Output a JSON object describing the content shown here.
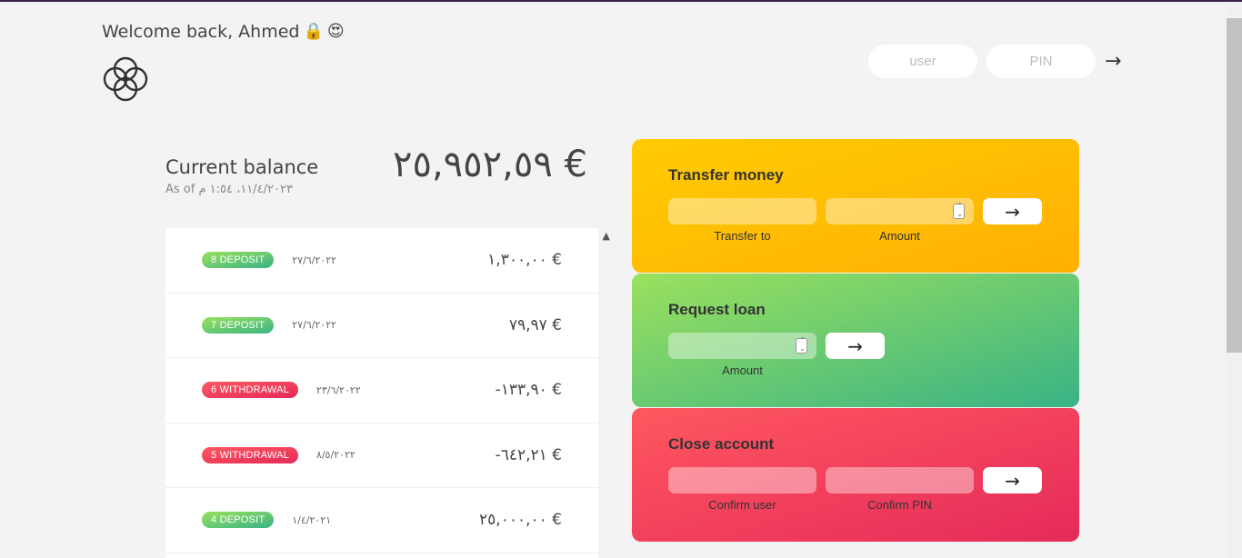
{
  "header": {
    "welcome": "Welcome back, Ahmed",
    "emoji_1": "🔒",
    "emoji_2": "😍",
    "user_placeholder": "user",
    "pin_placeholder": "PIN",
    "login_arrow": "→"
  },
  "balance": {
    "label": "Current balance",
    "date": "As of ١١/٤/٢٠٢٣، ١:٥٤ م",
    "value": "٢٥,٩٥٢,٥٩ €"
  },
  "movements": [
    {
      "type": "deposit",
      "label": "8 DEPOSIT",
      "date": "٢٧/٦/٢٠٢٢",
      "value": "١,٣٠٠,٠٠ €"
    },
    {
      "type": "deposit",
      "label": "7 DEPOSIT",
      "date": "٢٧/٦/٢٠٢٢",
      "value": "٧٩,٩٧ €"
    },
    {
      "type": "withdrawal",
      "label": "6 WITHDRAWAL",
      "date": "٢٣/٦/٢٠٢٢",
      "value": "-١٣٣,٩٠ €"
    },
    {
      "type": "withdrawal",
      "label": "5 WITHDRAWAL",
      "date": "٨/٥/٢٠٢٢",
      "value": "-٦٤٢,٢١ €"
    },
    {
      "type": "deposit",
      "label": "4 DEPOSIT",
      "date": "١/٤/٢٠٢١",
      "value": "٢٥,٠٠٠,٠٠ €"
    }
  ],
  "operations": {
    "transfer": {
      "title": "Transfer money",
      "label_1": "Transfer to",
      "label_2": "Amount",
      "button": "→"
    },
    "loan": {
      "title": "Request loan",
      "label_1": "Amount",
      "button": "→"
    },
    "close": {
      "title": "Close account",
      "label_1": "Confirm user",
      "label_2": "Confirm PIN",
      "button": "→"
    }
  },
  "colors": {
    "transfer": "#ffb003",
    "loan": "#39b385",
    "close": "#e52a5a"
  }
}
